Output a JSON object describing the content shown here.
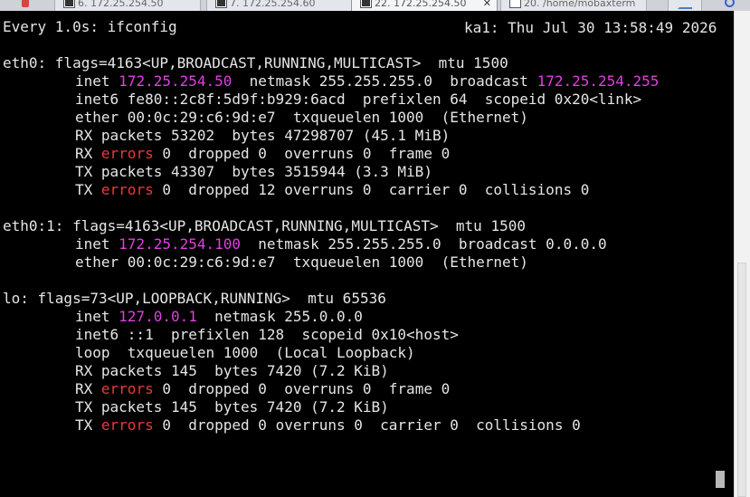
{
  "tabs": [
    {
      "label": "6. 172.25.254.50"
    },
    {
      "label": "7. 172.25.254.60"
    },
    {
      "label": "22. 172.25.254.50",
      "active": true
    },
    {
      "label": "20. /home/mobaxterm"
    }
  ],
  "terminal": {
    "header_left": "Every 1.0s: ifconfig",
    "header_right": "ka1: Thu Jul 30 13:58:49 2026",
    "eth0": {
      "flags": "eth0: flags=4163<UP,BROADCAST,RUNNING,MULTICAST>  mtu 1500",
      "inet_kw": "inet ",
      "inet_addr": "172.25.254.50",
      "inet_mid": "  netmask 255.255.255.0  broadcast ",
      "inet_bcast": "172.25.254.255",
      "inet6": "inet6 fe80::2c8f:5d9f:b929:6acd  prefixlen 64  scopeid 0x20<link>",
      "ether": "ether 00:0c:29:c6:9d:e7  txqueuelen 1000  (Ethernet)",
      "rx_packets": "RX packets 53202  bytes 47298707 (45.1 MiB)",
      "rx_err_pre": "RX ",
      "errors_word": "errors",
      "rx_err_post": " 0  dropped 0  overruns 0  frame 0",
      "tx_packets": "TX packets 43307  bytes 3515944 (3.3 MiB)",
      "tx_err_pre": "TX ",
      "tx_err_post": " 0  dropped 12 overruns 0  carrier 0  collisions 0"
    },
    "eth0_1": {
      "flags": "eth0:1: flags=4163<UP,BROADCAST,RUNNING,MULTICAST>  mtu 1500",
      "inet_kw": "inet ",
      "inet_addr": "172.25.254.100",
      "inet_mid": "  netmask 255.255.255.0  broadcast 0.0.0.0",
      "ether": "ether 00:0c:29:c6:9d:e7  txqueuelen 1000  (Ethernet)"
    },
    "lo": {
      "flags": "lo: flags=73<UP,LOOPBACK,RUNNING>  mtu 65536",
      "inet_kw": "inet ",
      "inet_addr": "127.0.0.1",
      "inet_mid": "  netmask 255.0.0.0",
      "inet6": "inet6 ::1  prefixlen 128  scopeid 0x10<host>",
      "loop": "loop  txqueuelen 1000  (Local Loopback)",
      "rx_packets": "RX packets 145  bytes 7420 (7.2 KiB)",
      "rx_err_pre": "RX ",
      "errors_word": "errors",
      "rx_err_post": " 0  dropped 0  overruns 0  frame 0",
      "tx_packets": "TX packets 145  bytes 7420 (7.2 KiB)",
      "tx_err_pre": "TX ",
      "tx_err_post": " 0  dropped 0 overruns 0  carrier 0  collisions 0"
    }
  },
  "colors": {
    "background": "#000000",
    "text": "#e5e5e5",
    "highlight_address": "#e040e0",
    "highlight_error": "#e83a3a"
  }
}
